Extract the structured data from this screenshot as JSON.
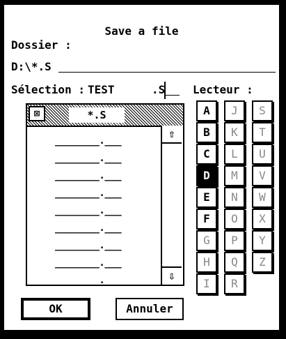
{
  "dialog": {
    "title": "Save a file",
    "folder_label": "Dossier :",
    "path_value": "D:\\*.S",
    "selection_label": "Sélection :",
    "selection_name": "TEST",
    "selection_ext": ".S",
    "drive_label": "Lecteur :"
  },
  "file_list": {
    "mask": "*.S",
    "close_glyph": "⊠",
    "scroll_up_glyph": "⇧",
    "scroll_down_glyph": "⇩",
    "rows": [
      "________.___",
      "________.___",
      "________.___",
      "________.___",
      "________.___",
      "________.___",
      "________.___",
      "________.___",
      "________.___"
    ]
  },
  "drives": [
    {
      "letter": "A",
      "enabled": true,
      "selected": false
    },
    {
      "letter": "B",
      "enabled": true,
      "selected": false
    },
    {
      "letter": "C",
      "enabled": true,
      "selected": false
    },
    {
      "letter": "D",
      "enabled": true,
      "selected": true
    },
    {
      "letter": "E",
      "enabled": true,
      "selected": false
    },
    {
      "letter": "F",
      "enabled": true,
      "selected": false
    },
    {
      "letter": "G",
      "enabled": false,
      "selected": false
    },
    {
      "letter": "H",
      "enabled": false,
      "selected": false
    },
    {
      "letter": "I",
      "enabled": false,
      "selected": false
    },
    {
      "letter": "J",
      "enabled": false,
      "selected": false
    },
    {
      "letter": "K",
      "enabled": false,
      "selected": false
    },
    {
      "letter": "L",
      "enabled": false,
      "selected": false
    },
    {
      "letter": "M",
      "enabled": false,
      "selected": false
    },
    {
      "letter": "N",
      "enabled": false,
      "selected": false
    },
    {
      "letter": "O",
      "enabled": false,
      "selected": false
    },
    {
      "letter": "P",
      "enabled": false,
      "selected": false
    },
    {
      "letter": "Q",
      "enabled": false,
      "selected": false
    },
    {
      "letter": "R",
      "enabled": false,
      "selected": false
    },
    {
      "letter": "S",
      "enabled": false,
      "selected": false
    },
    {
      "letter": "T",
      "enabled": false,
      "selected": false
    },
    {
      "letter": "U",
      "enabled": false,
      "selected": false
    },
    {
      "letter": "V",
      "enabled": false,
      "selected": false
    },
    {
      "letter": "W",
      "enabled": false,
      "selected": false
    },
    {
      "letter": "X",
      "enabled": false,
      "selected": false
    },
    {
      "letter": "Y",
      "enabled": false,
      "selected": false
    },
    {
      "letter": "Z",
      "enabled": false,
      "selected": false
    }
  ],
  "buttons": {
    "ok": "OK",
    "cancel": "Annuler"
  }
}
